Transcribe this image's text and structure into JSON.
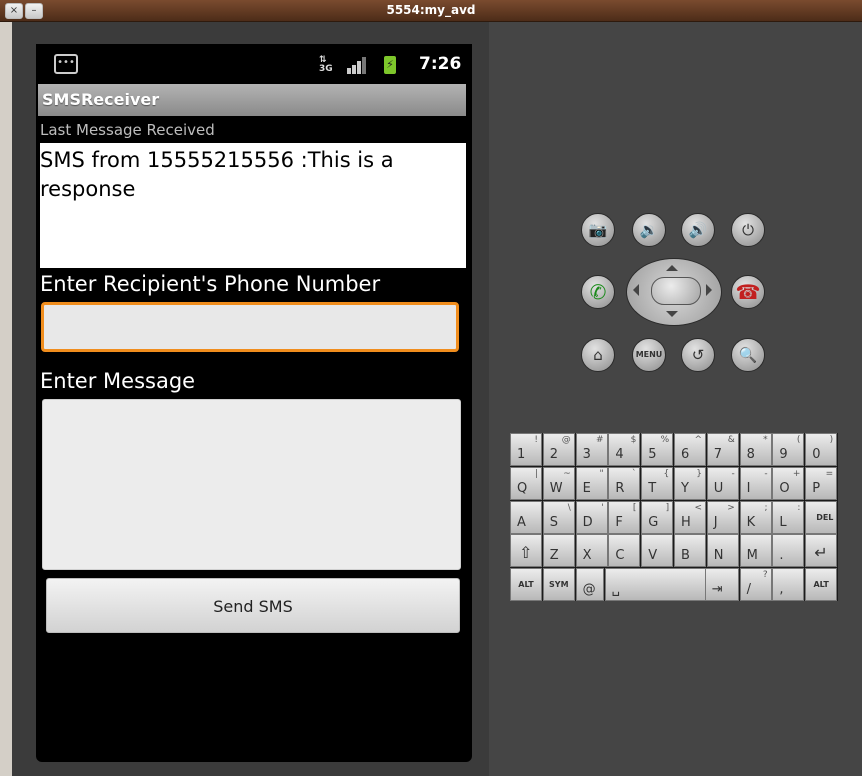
{
  "window": {
    "title": "5554:my_avd",
    "close_glyph": "×",
    "min_glyph": "–"
  },
  "status_bar": {
    "time": "7:26",
    "network_label": "3G",
    "battery_glyph": "⚡",
    "notification_glyph": "•••"
  },
  "app": {
    "title": "SMSReceiver",
    "last_message_label": "Last Message Received",
    "last_message_text": "SMS from 15555215556 :This is a response",
    "phone_label": "Enter Recipient's Phone Number",
    "phone_value": "",
    "message_label": "Enter Message",
    "message_value": "",
    "send_button": "Send SMS"
  },
  "controls": {
    "camera": "📷",
    "vol_down": "🔉",
    "vol_up": "🔊",
    "power": "⏻",
    "call": "✆",
    "end_call": "☎",
    "home": "⌂",
    "menu": "MENU",
    "back": "↺",
    "search": "🔍"
  },
  "keyboard": {
    "rows": [
      [
        {
          "k": "1",
          "a": "!"
        },
        {
          "k": "2",
          "a": "@"
        },
        {
          "k": "3",
          "a": "#"
        },
        {
          "k": "4",
          "a": "$"
        },
        {
          "k": "5",
          "a": "%"
        },
        {
          "k": "6",
          "a": "^"
        },
        {
          "k": "7",
          "a": "&"
        },
        {
          "k": "8",
          "a": "*"
        },
        {
          "k": "9",
          "a": "("
        },
        {
          "k": "0",
          "a": ")"
        }
      ],
      [
        {
          "k": "Q",
          "a": "|"
        },
        {
          "k": "W",
          "a": "~"
        },
        {
          "k": "E",
          "a": "\""
        },
        {
          "k": "R",
          "a": "`"
        },
        {
          "k": "T",
          "a": "{"
        },
        {
          "k": "Y",
          "a": "}"
        },
        {
          "k": "U",
          "a": "-"
        },
        {
          "k": "I",
          "a": "-"
        },
        {
          "k": "O",
          "a": "+"
        },
        {
          "k": "P",
          "a": "="
        }
      ],
      [
        {
          "k": "A",
          "a": ""
        },
        {
          "k": "S",
          "a": "\\"
        },
        {
          "k": "D",
          "a": "'"
        },
        {
          "k": "F",
          "a": "["
        },
        {
          "k": "G",
          "a": "]"
        },
        {
          "k": "H",
          "a": "<"
        },
        {
          "k": "J",
          "a": ">"
        },
        {
          "k": "K",
          "a": ";"
        },
        {
          "k": "L",
          "a": ":"
        },
        {
          "k": "DEL",
          "a": ""
        }
      ],
      [
        {
          "k": "⇧",
          "a": ""
        },
        {
          "k": "Z",
          "a": ""
        },
        {
          "k": "X",
          "a": ""
        },
        {
          "k": "C",
          "a": ""
        },
        {
          "k": "V",
          "a": ""
        },
        {
          "k": "B",
          "a": ""
        },
        {
          "k": "N",
          "a": ""
        },
        {
          "k": "M",
          "a": ""
        },
        {
          "k": ".",
          "a": ""
        },
        {
          "k": "↵",
          "a": ""
        }
      ]
    ],
    "bottom": {
      "alt_left": "ALT",
      "sym": "SYM",
      "at": "@",
      "space": "␣",
      "tab": "⇥",
      "slash": "/",
      "slash_alt": "?",
      "comma": ",",
      "alt_right": "ALT"
    }
  }
}
